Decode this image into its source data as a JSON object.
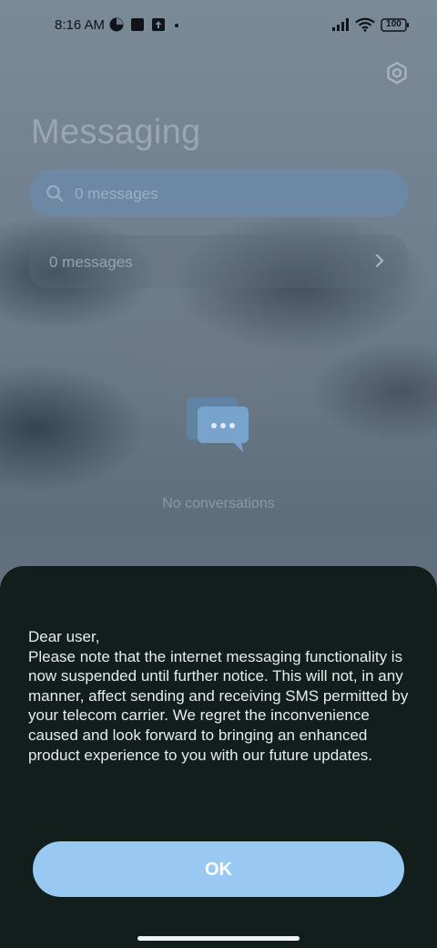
{
  "status_bar": {
    "time": "8:16 AM",
    "battery": "100",
    "icons": [
      "notification-icon",
      "square-app-icon",
      "upload-icon",
      "signal-icon",
      "wifi-icon",
      "battery-icon"
    ]
  },
  "header": {
    "title": "Messaging",
    "settings_icon": "gear-icon"
  },
  "search": {
    "placeholder": "0 messages",
    "icon": "search-icon"
  },
  "filter_row": {
    "label": "0 messages",
    "icon": "chevron-right-icon"
  },
  "empty_state": {
    "icon": "chat-bubbles-icon",
    "text": "No conversations"
  },
  "dialog": {
    "message": "Dear user,\nPlease note that the internet messaging functionality is now suspended until further notice. This will not, in any manner, affect sending and receiving SMS permitted by your telecom carrier. We regret the inconvenience caused and look forward to bringing an enhanced product experience to you with our future updates.",
    "ok_label": "OK"
  },
  "colors": {
    "sheet_bg": "#121e1c",
    "ok_button": "#98c9f2",
    "accent": "#6a9cc8"
  }
}
